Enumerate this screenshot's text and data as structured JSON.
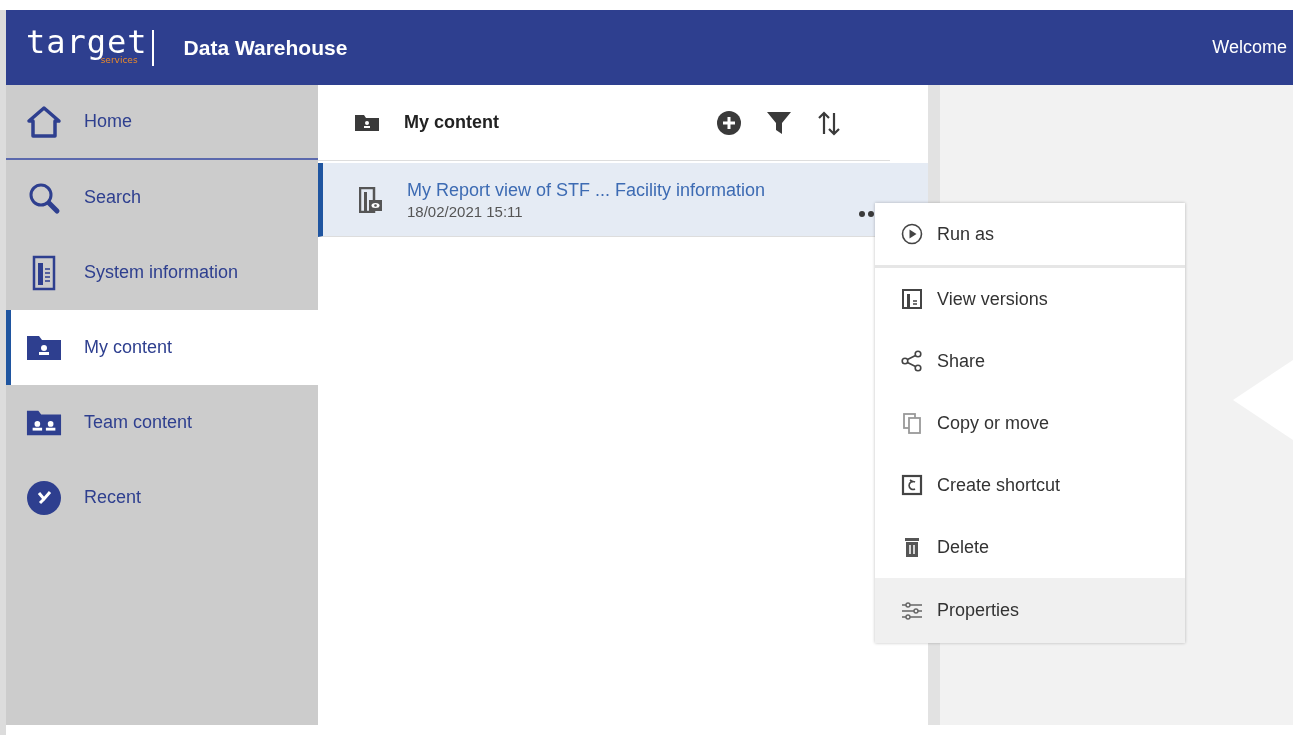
{
  "header": {
    "logo": {
      "word": "target",
      "sub": "services"
    },
    "title": "Data Warehouse",
    "welcome": "Welcome"
  },
  "sidebar": {
    "items": [
      {
        "label": "Home",
        "selected": false
      },
      {
        "label": "Search",
        "selected": false
      },
      {
        "label": "System information",
        "selected": false
      },
      {
        "label": "My content",
        "selected": true
      },
      {
        "label": "Team content",
        "selected": false
      },
      {
        "label": "Recent",
        "selected": false
      }
    ]
  },
  "content": {
    "title": "My content",
    "items": [
      {
        "name": "My Report view of STF ... Facility information",
        "date": "18/02/2021 15:11",
        "selected": true
      }
    ]
  },
  "context_menu": {
    "items": [
      {
        "label": "Run as",
        "divider_after": true,
        "selected": false
      },
      {
        "label": "View versions",
        "divider_after": false,
        "selected": false
      },
      {
        "label": "Share",
        "divider_after": false,
        "selected": false
      },
      {
        "label": "Copy or move",
        "divider_after": false,
        "selected": false
      },
      {
        "label": "Create shortcut",
        "divider_after": false,
        "selected": false
      },
      {
        "label": "Delete",
        "divider_after": false,
        "selected": false
      },
      {
        "label": "Properties",
        "divider_after": false,
        "selected": true
      }
    ]
  }
}
